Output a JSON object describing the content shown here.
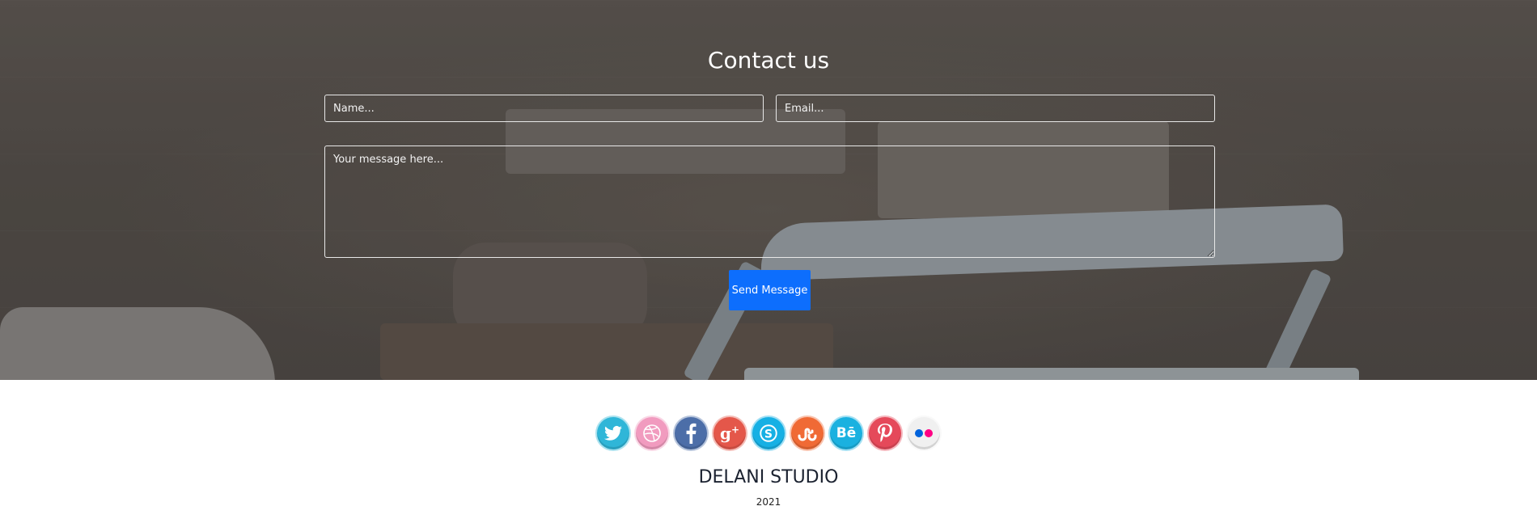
{
  "contact": {
    "title": "Contact us",
    "name_placeholder": "Name...",
    "email_placeholder": "Email...",
    "message_placeholder": "Your message here...",
    "send_label": "Send Message"
  },
  "social": [
    {
      "name": "twitter-icon",
      "color": "#2fb6d8"
    },
    {
      "name": "dribbble-icon",
      "color": "#f19bbf"
    },
    {
      "name": "facebook-icon",
      "color": "#4c6ea8"
    },
    {
      "name": "google-plus-icon",
      "color": "#e4574a"
    },
    {
      "name": "skype-icon",
      "color": "#16b0e4"
    },
    {
      "name": "stumbleupon-icon",
      "color": "#f06a35"
    },
    {
      "name": "behance-icon",
      "color": "#1ab1e0"
    },
    {
      "name": "pinterest-icon",
      "color": "#e5495a"
    },
    {
      "name": "flickr-icon",
      "color": "#f0f0f0"
    }
  ],
  "footer": {
    "studio": "DELANI STUDIO",
    "year": "2021"
  },
  "colors": {
    "accent": "#0d6efd",
    "flickr_blue": "#0063dc",
    "flickr_pink": "#ff0084"
  }
}
